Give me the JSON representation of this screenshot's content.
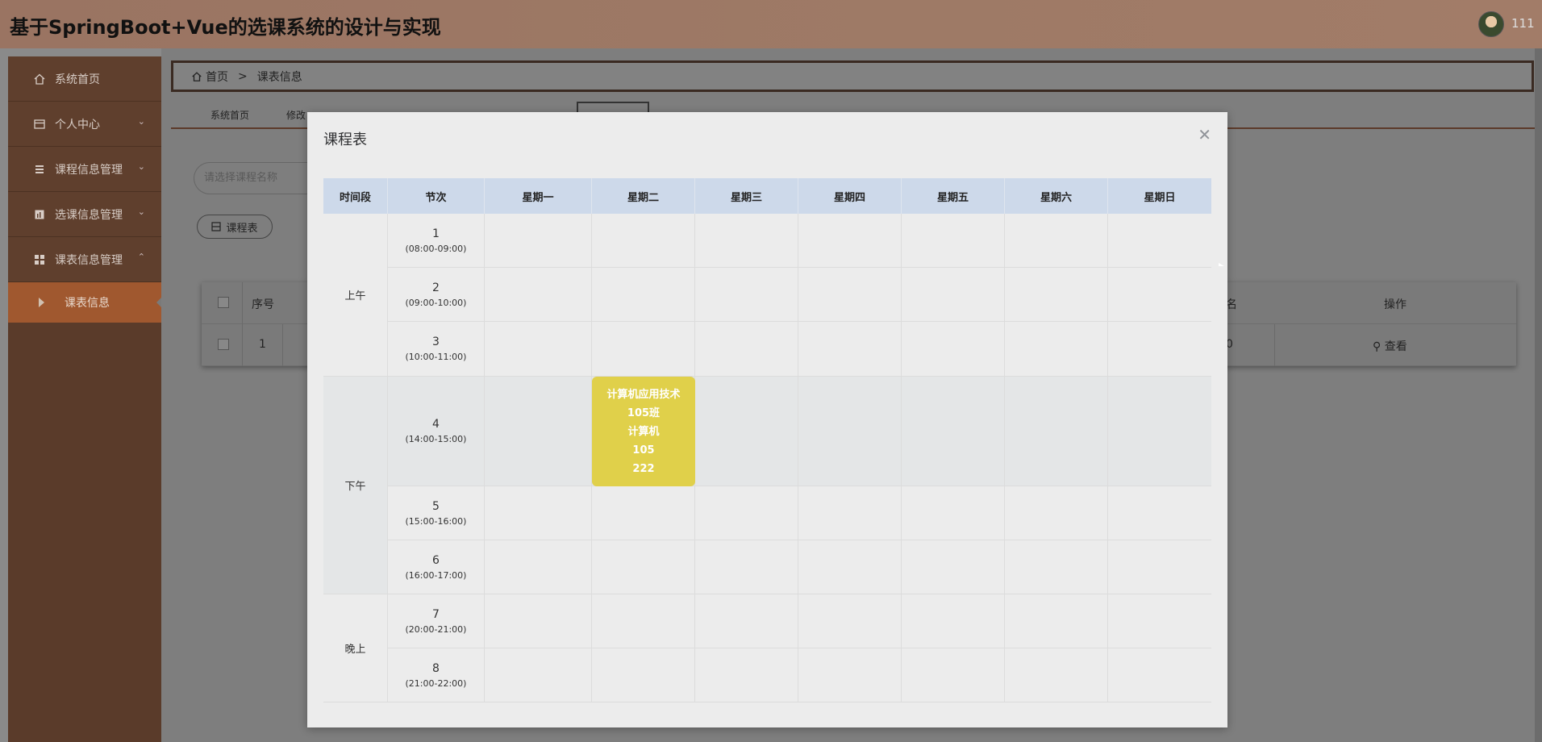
{
  "header": {
    "title": "基于SpringBoot+Vue的选课系统的设计与实现",
    "user": "111"
  },
  "sidebar": {
    "items": [
      {
        "label": "系统首页",
        "icon": "home-icon"
      },
      {
        "label": "个人中心",
        "icon": "wallet-icon"
      },
      {
        "label": "课程信息管理",
        "icon": "list-icon"
      },
      {
        "label": "选课信息管理",
        "icon": "chart-icon"
      },
      {
        "label": "课表信息管理",
        "icon": "grid-icon"
      }
    ],
    "active_sub": "课表信息"
  },
  "breadcrumb": {
    "home": "首页",
    "separator": ">",
    "current": "课表信息"
  },
  "tabs": {
    "first": "系统首页",
    "second": "修改"
  },
  "search": {
    "placeholder": "请选择课程名称"
  },
  "buttons": {
    "schedule": "课程表"
  },
  "table": {
    "headers": {
      "index": "序号",
      "name_partial": "名",
      "actions": "操作"
    },
    "rows": [
      {
        "index": "1",
        "name_partial": "0",
        "action": "查看"
      }
    ]
  },
  "dialog": {
    "title": "课程表",
    "columns": [
      "时间段",
      "节次",
      "星期一",
      "星期二",
      "星期三",
      "星期四",
      "星期五",
      "星期六",
      "星期日"
    ],
    "periods": [
      "上午",
      "下午",
      "晚上"
    ],
    "sessions": [
      {
        "num": "1",
        "time": "(08:00-09:00)"
      },
      {
        "num": "2",
        "time": "(09:00-10:00)"
      },
      {
        "num": "3",
        "time": "(10:00-11:00)"
      },
      {
        "num": "4",
        "time": "(14:00-15:00)"
      },
      {
        "num": "5",
        "time": "(15:00-16:00)"
      },
      {
        "num": "6",
        "time": "(16:00-17:00)"
      },
      {
        "num": "7",
        "time": "(20:00-21:00)"
      },
      {
        "num": "8",
        "time": "(21:00-22:00)"
      }
    ],
    "course": {
      "name": "计算机应用技术",
      "class": "105班",
      "teacher": "计算机",
      "room": "105",
      "extra": "222",
      "color": "#e0d04a"
    }
  }
}
